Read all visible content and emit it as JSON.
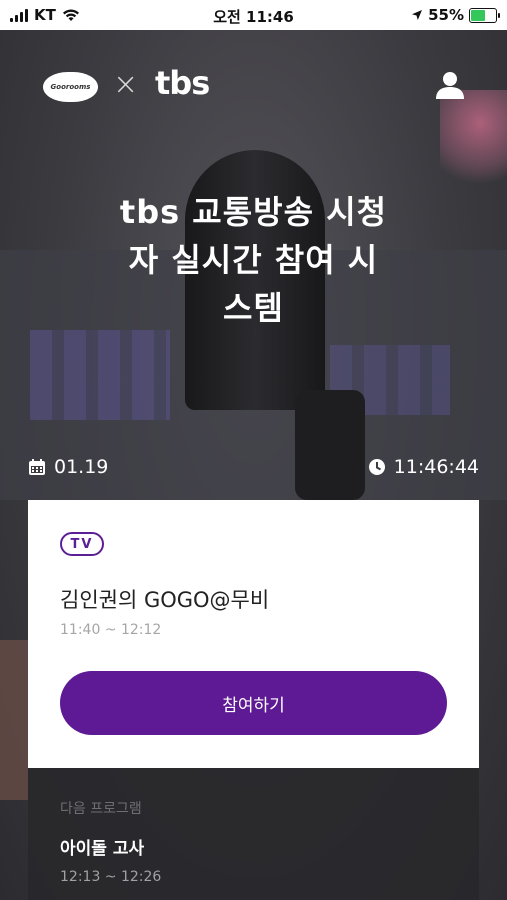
{
  "status_bar": {
    "carrier": "KT",
    "time": "오전 11:46",
    "battery": "55%"
  },
  "header": {
    "partner_logo": "Goorooms",
    "separator": "×",
    "brand": "tbs"
  },
  "hero": {
    "title_line1": "tbs 교통방송 시청",
    "title_line2": "자 실시간 참여 시",
    "title_line3": "스템"
  },
  "info": {
    "date": "01.19",
    "clock": "11:46:44"
  },
  "current_program": {
    "badge": "TV",
    "title": "김인권의 GOGO@무비",
    "time": "11:40 ~ 12:12",
    "join_label": "참여하기"
  },
  "next_program": {
    "label": "다음 프로그램",
    "title": "아이돌 고사",
    "time": "12:13 ~ 12:26"
  },
  "colors": {
    "accent": "#5e1a94",
    "battery": "#34c759"
  }
}
